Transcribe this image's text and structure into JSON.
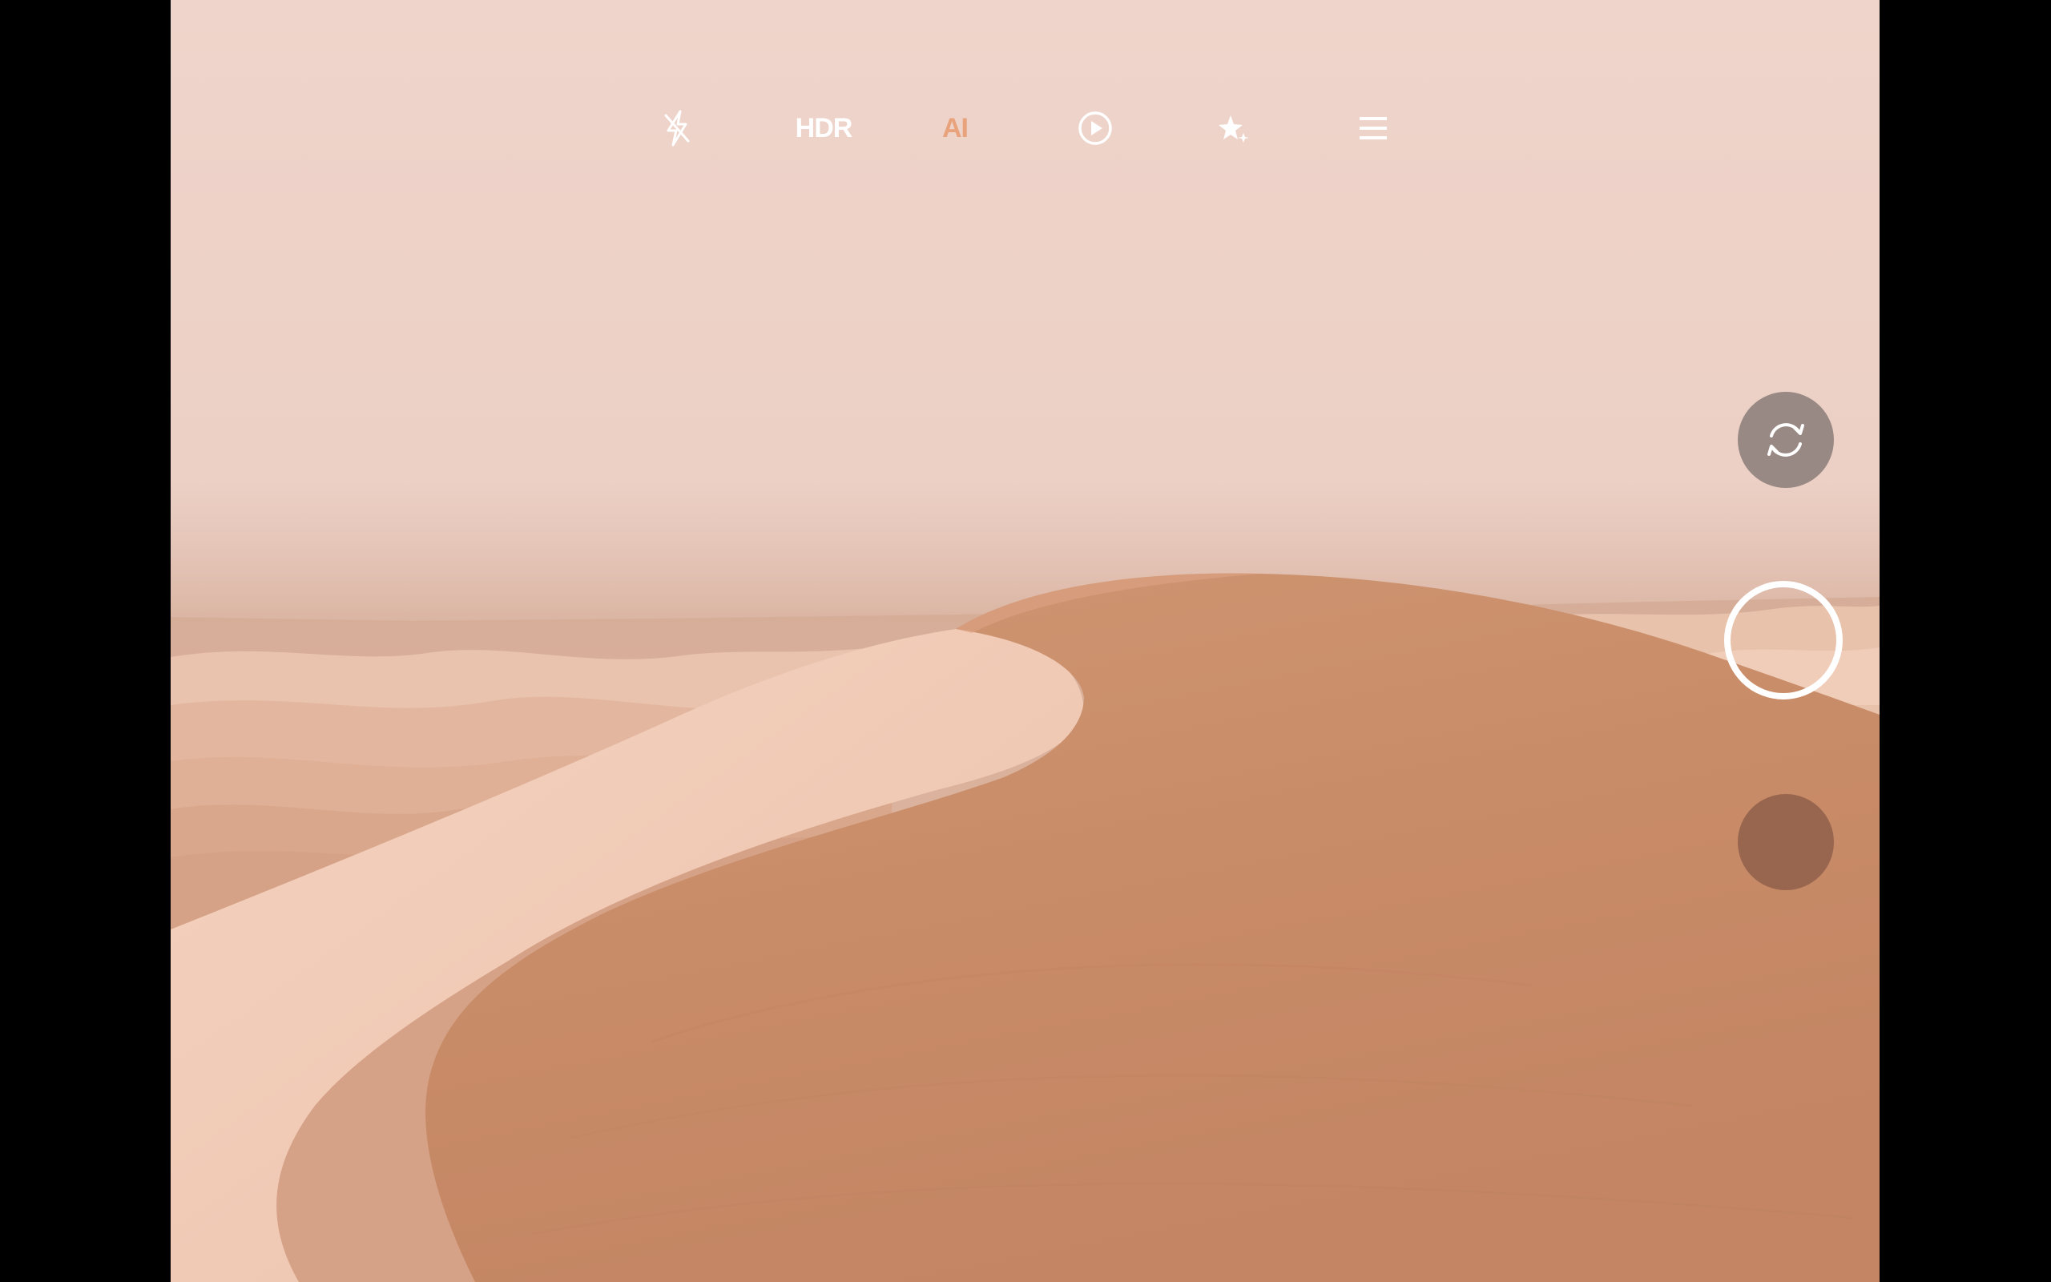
{
  "toolbar": {
    "flash": {
      "icon": "flash-off-icon"
    },
    "hdr": {
      "label": "HDR"
    },
    "ai": {
      "label": "AI",
      "color": "#e8a37c"
    },
    "live": {
      "icon": "live-photo-icon"
    },
    "beauty": {
      "icon": "beauty-sparkle-icon"
    },
    "menu": {
      "icon": "menu-icon"
    }
  },
  "controls": {
    "switch_camera": {
      "icon": "switch-camera-icon"
    },
    "shutter": {
      "icon": "shutter-icon"
    },
    "gallery": {
      "icon": "gallery-thumbnail"
    }
  },
  "colors": {
    "sky": "#efd3c9",
    "dune_shadow": "#c98e6a",
    "dune_light": "#f1cbb6",
    "accent_ai": "#e8a37c"
  }
}
